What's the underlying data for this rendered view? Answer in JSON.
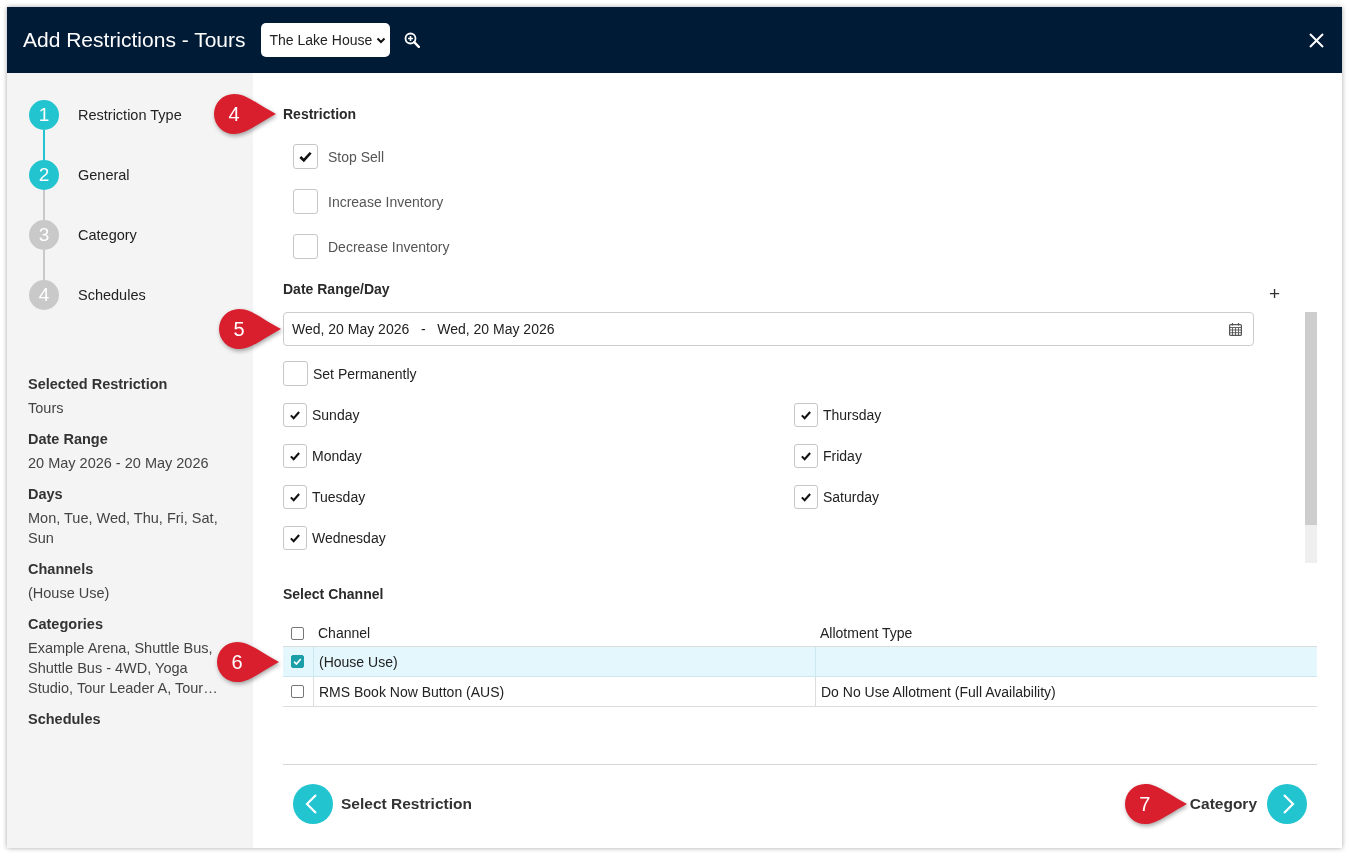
{
  "window": {
    "title": "Add Restrictions - Tours",
    "property": "The Lake House"
  },
  "steps": [
    {
      "number": "1",
      "label": "Restriction Type",
      "done": true
    },
    {
      "number": "2",
      "label": "General",
      "done": true
    },
    {
      "number": "3",
      "label": "Category",
      "done": false
    },
    {
      "number": "4",
      "label": "Schedules",
      "done": false
    }
  ],
  "summary": [
    {
      "heading": "Selected Restriction",
      "value": "Tours"
    },
    {
      "heading": "Date Range",
      "value": "20 May 2026 - 20 May 2026"
    },
    {
      "heading": "Days",
      "value": "Mon, Tue, Wed, Thu, Fri, Sat, Sun"
    },
    {
      "heading": "Channels",
      "value": "(House Use)"
    },
    {
      "heading": "Categories",
      "value": "Example Arena, Shuttle Bus, Shuttle Bus - 4WD, Yoga Studio, Tour Leader A, Tour…"
    },
    {
      "heading": "Schedules"
    }
  ],
  "restriction": {
    "heading": "Restriction",
    "callout": "4",
    "options": [
      {
        "label": "Stop Sell",
        "checked": true
      },
      {
        "label": "Increase Inventory",
        "checked": false
      },
      {
        "label": "Decrease Inventory",
        "checked": false
      }
    ]
  },
  "date_range": {
    "heading": "Date Range/Day",
    "add": "+",
    "value": "Wed, 20 May 2026   -   Wed, 20 May 2026",
    "callout": "5",
    "set_permanently": {
      "label": "Set Permanently",
      "checked": false
    },
    "days": [
      {
        "label": "Sunday",
        "checked": true
      },
      {
        "label": "Monday",
        "checked": true
      },
      {
        "label": "Tuesday",
        "checked": true
      },
      {
        "label": "Wednesday",
        "checked": true
      },
      {
        "label": "Thursday",
        "checked": true
      },
      {
        "label": "Friday",
        "checked": true
      },
      {
        "label": "Saturday",
        "checked": true
      }
    ]
  },
  "channels": {
    "heading": "Select Channel",
    "select_all": {
      "checked": false
    },
    "columns": [
      "Channel",
      "Allotment Type"
    ],
    "rows": [
      {
        "channel": "(House Use)",
        "checked": true,
        "selected": true,
        "callout": "6"
      },
      {
        "channel": "RMS Book Now Button (AUS)",
        "allotment_type": "Do No Use Allotment (Full Availability)",
        "checked": false,
        "selected": false
      }
    ]
  },
  "footer": {
    "back": {
      "label": "Select Restriction"
    },
    "next": {
      "label": "Category",
      "callout": "7"
    }
  }
}
